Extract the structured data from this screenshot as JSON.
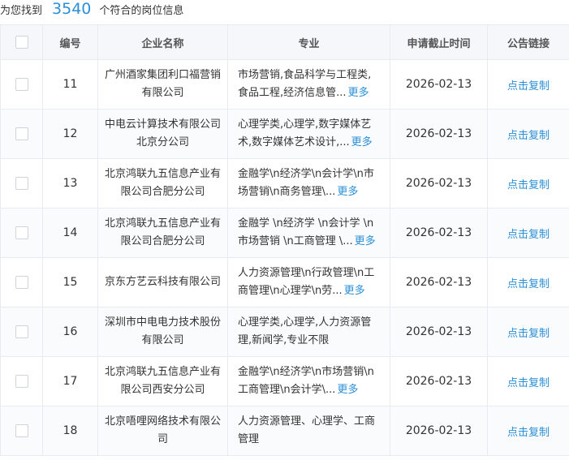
{
  "summary": {
    "prefix": "为您找到",
    "count": "3540",
    "suffix": "个符合的岗位信息"
  },
  "table": {
    "headers": [
      "编号",
      "企业名称",
      "专业",
      "申请截止时间",
      "公告链接"
    ],
    "more_label": "更多",
    "rows": [
      {
        "id": "11",
        "company": "广州酒家集团利口福营销有限公司",
        "major": "市场营销,食品科学与工程类,食品工程,经济信息管...",
        "has_more": true,
        "deadline": "2026-02-13",
        "link": "点击复制"
      },
      {
        "id": "12",
        "company": "中电云计算技术有限公司北京分公司",
        "major": "心理学类,心理学,数字媒体艺术,数字媒体艺术设计,...",
        "has_more": true,
        "deadline": "2026-02-13",
        "link": "点击复制"
      },
      {
        "id": "13",
        "company": "北京鸿联九五信息产业有限公司合肥分公司",
        "major": "金融学\\n经济学\\n会计学\\n市场营销\\n商务管理\\...",
        "has_more": true,
        "deadline": "2026-02-13",
        "link": "点击复制"
      },
      {
        "id": "14",
        "company": "北京鸿联九五信息产业有限公司合肥分公司",
        "major": "金融学 \\n经济学 \\n会计学 \\n市场营销 \\n工商管理 \\...",
        "has_more": true,
        "deadline": "2026-02-13",
        "link": "点击复制"
      },
      {
        "id": "15",
        "company": "京东方艺云科技有限公司",
        "major": "人力资源管理\\n行政管理\\n工商管理\\n心理学\\n劳...",
        "has_more": true,
        "deadline": "2026-02-13",
        "link": "点击复制"
      },
      {
        "id": "16",
        "company": "深圳市中电电力技术股份有限公司",
        "major": "心理学类,心理学,人力资源管理,新闻学,专业不限",
        "has_more": false,
        "deadline": "2026-02-13",
        "link": "点击复制"
      },
      {
        "id": "17",
        "company": "北京鸿联九五信息产业有限公司西安分公司",
        "major": "金融学\\n经济学\\n市场营销\\n工商管理\\n会计学\\...",
        "has_more": true,
        "deadline": "2026-02-13",
        "link": "点击复制"
      },
      {
        "id": "18",
        "company": "北京唔哩网络技术有限公司",
        "major": "人力资源管理、心理学、工商管理",
        "has_more": false,
        "deadline": "2026-02-13",
        "link": "点击复制"
      }
    ]
  },
  "colors": {
    "accent": "#2a8fd6",
    "header_bg": "#f5f7fa",
    "border": "#e8ebef"
  }
}
